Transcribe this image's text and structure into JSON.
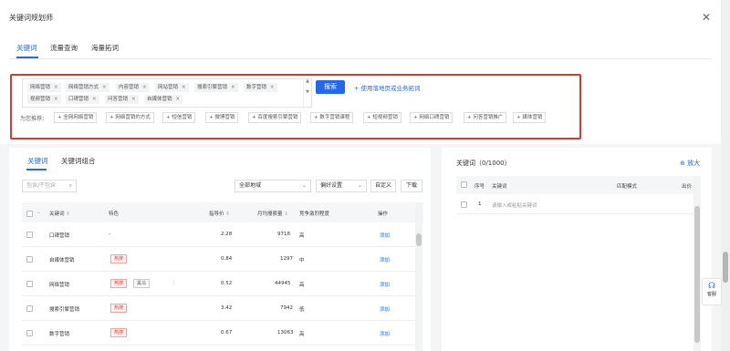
{
  "dialog": {
    "title": "关键词规划师",
    "close_glyph": "✕"
  },
  "tabs": [
    {
      "label": "关键词",
      "active": true
    },
    {
      "label": "流量查询",
      "active": false
    },
    {
      "label": "海量拓词",
      "active": false
    }
  ],
  "seed_tags": [
    "网络营销",
    "网络营销方式",
    "内容营销",
    "网站营销",
    "搜索引擎营销",
    "数字营销",
    "视频营销",
    "口碑营销",
    "问答营销",
    "自媒体营销"
  ],
  "tag_remove_glyph": "✕",
  "search": {
    "button_label": "搜索",
    "add_link": "+ 使用落地页或业务拓词"
  },
  "recommend": {
    "label": "为您推荐：",
    "items": [
      "+ 全网网络营销",
      "+ 网络营销的方式",
      "+ 短信营销",
      "+ 微博营销",
      "+ 百度搜索引擎营销",
      "+ 数字营销课程",
      "+ 短视频营销",
      "+ 网络口碑营销",
      "+ 问答营销推广",
      "+ 媒体营销"
    ]
  },
  "results": {
    "subtabs": [
      {
        "label": "关键词",
        "active": true
      },
      {
        "label": "关键词组合",
        "active": false
      }
    ],
    "filter_placeholder": "包含/不包含",
    "region_select": "全部地域",
    "pref_button": "偏好设置",
    "custom_button": "自定义",
    "download_button": "下载",
    "columns": {
      "keyword": "关键词",
      "feature": "特色",
      "bid": "指导价",
      "volume": "月均搜索量",
      "competition": "竞争激烈程度",
      "action": "操作"
    },
    "rows": [
      {
        "keyword": "口碑营销",
        "feature_text": "-",
        "hot": "",
        "extra": "",
        "bid": "2.28",
        "volume": "9718",
        "competition": "高",
        "action": "添加"
      },
      {
        "keyword": "自媒体营销",
        "feature_text": "",
        "hot": "热搜",
        "extra": "",
        "bid": "0.84",
        "volume": "1297",
        "competition": "中",
        "action": "添加"
      },
      {
        "keyword": "网络营销",
        "feature_text": "",
        "hot": "热搜",
        "extra": "黑马",
        "bid": "0.52",
        "volume": "44945",
        "competition": "高",
        "action": "添加"
      },
      {
        "keyword": "搜索引擎营销",
        "feature_text": "",
        "hot": "热搜",
        "extra": "",
        "bid": "3.42",
        "volume": "7942",
        "competition": "低",
        "action": "添加"
      },
      {
        "keyword": "数字营销",
        "feature_text": "",
        "hot": "热搜",
        "extra": "",
        "bid": "0.67",
        "volume": "13063",
        "competition": "高",
        "action": "添加"
      }
    ]
  },
  "selected": {
    "title": "关键词（0/1000）",
    "zoom_label": "放大",
    "columns": {
      "index": "序号",
      "keyword": "关键词",
      "match": "匹配模式",
      "bid": "出价"
    },
    "row": {
      "index": "1",
      "placeholder": "请输入或粘贴关键词"
    }
  },
  "helper": {
    "label": "客服"
  },
  "colors": {
    "accent": "#2468f2",
    "highlight_border": "#e8332a",
    "hot_tag": "#e8332a"
  }
}
